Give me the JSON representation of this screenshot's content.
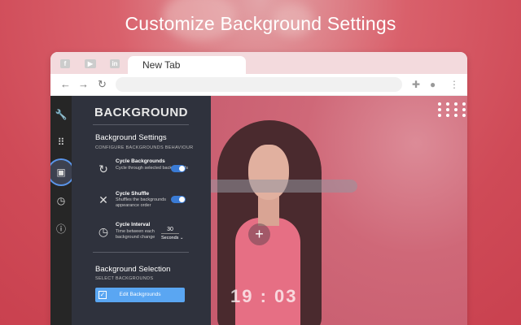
{
  "headline": "Customize Background Settings",
  "browser": {
    "tab_title": "New Tab",
    "social_icons": [
      "facebook-icon",
      "youtube-icon",
      "linkedin-icon"
    ]
  },
  "rail": {
    "items": [
      {
        "icon": "wrench-icon",
        "glyph": "🔧"
      },
      {
        "icon": "grid-icon",
        "glyph": "⠿"
      },
      {
        "icon": "image-icon",
        "glyph": "▣",
        "active": true
      },
      {
        "icon": "clock-icon",
        "glyph": "◷"
      },
      {
        "icon": "info-icon",
        "glyph": "ⓘ"
      }
    ]
  },
  "panel": {
    "title": "BACKGROUND",
    "settings": {
      "title": "Background Settings",
      "subtitle": "CONFIGURE BACKGROUNDS BEHAVIOUR",
      "cycle": {
        "title": "Cycle Backgrounds",
        "desc": "Cycle through selected backgrounds",
        "enabled": true
      },
      "shuffle": {
        "title": "Cycle Shuffle",
        "desc": "Shuffles the backgrounds appearance order",
        "enabled": true
      },
      "interval": {
        "title": "Cycle Interval",
        "desc": "Time between each background change",
        "value": "30",
        "unit": "Seconds ⌄"
      }
    },
    "selection": {
      "title": "Background Selection",
      "subtitle": "SELECT BACKGROUNDS",
      "button": "Edit Backgrounds"
    }
  },
  "newtab": {
    "clock": "19 : 03",
    "plus": "+"
  },
  "colors": {
    "accent": "#5aa6f2",
    "toggle": "#3a7bd5",
    "panel": "#2f323d",
    "rail": "#262626"
  }
}
